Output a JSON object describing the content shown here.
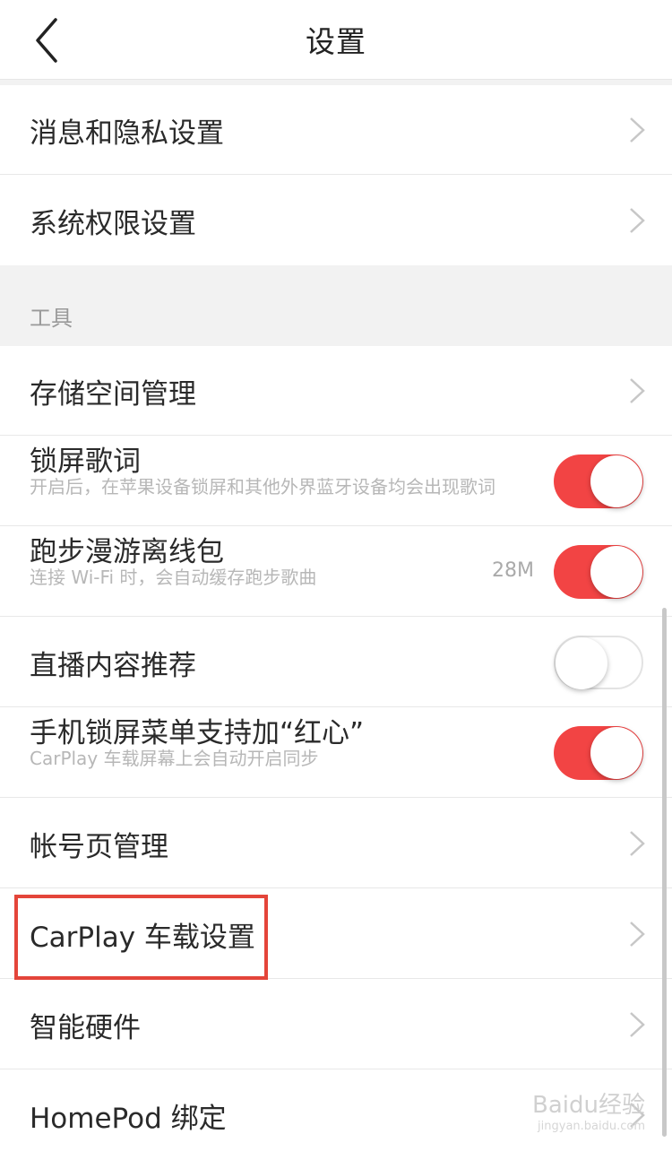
{
  "header": {
    "title": "设置"
  },
  "rows_top": [
    {
      "label": "消息和隐私设置"
    },
    {
      "label": "系统权限设置"
    }
  ],
  "section": {
    "tools_label": "工具"
  },
  "rows": [
    {
      "label": "存储空间管理",
      "kind": "link"
    },
    {
      "label": "锁屏歌词",
      "sub": "开启后，在苹果设备锁屏和其他外界蓝牙设备均会出现歌词",
      "kind": "toggle",
      "on": true
    },
    {
      "label": "跑步漫游离线包",
      "sub": "连接 Wi-Fi 时，会自动缓存跑步歌曲",
      "size": "28M",
      "kind": "toggle",
      "on": true
    },
    {
      "label": "直播内容推荐",
      "kind": "toggle",
      "on": false
    },
    {
      "label": "手机锁屏菜单支持加“红心”",
      "sub": "CarPlay 车载屏幕上会自动开启同步",
      "kind": "toggle",
      "on": true
    },
    {
      "label": "帐号页管理",
      "kind": "link"
    },
    {
      "label": "CarPlay 车载设置",
      "kind": "link",
      "highlighted": true
    },
    {
      "label": "智能硬件",
      "kind": "link"
    },
    {
      "label": "HomePod 绑定",
      "kind": "link"
    }
  ],
  "watermark": {
    "text": "Baidu经验",
    "sub": "jingyan.baidu.com"
  },
  "colors": {
    "accent": "#f24444",
    "highlight": "#e4453a"
  }
}
